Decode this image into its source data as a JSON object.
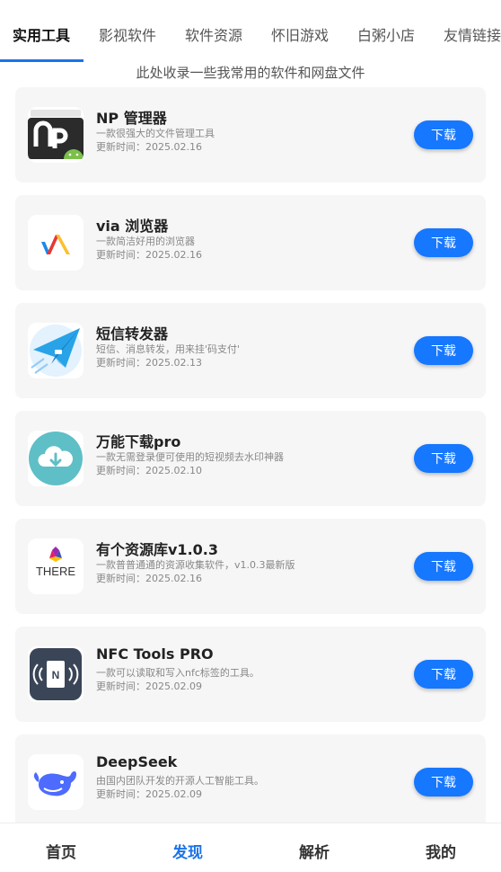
{
  "tabs": [
    {
      "label": "实用工具",
      "active": true
    },
    {
      "label": "影视软件",
      "active": false
    },
    {
      "label": "软件资源",
      "active": false
    },
    {
      "label": "怀旧游戏",
      "active": false
    },
    {
      "label": "白粥小店",
      "active": false
    },
    {
      "label": "友情链接",
      "active": false
    }
  ],
  "subtitle": "此处收录一些我常用的软件和网盘文件",
  "apps": [
    {
      "name": "NP 管理器",
      "desc": "一款很强大的文件管理工具",
      "time": "更新时间：2025.02.16",
      "icon": "np-manager-icon",
      "button": "下载"
    },
    {
      "name": "via 浏览器",
      "desc": "一款简洁好用的浏览器",
      "time": "更新时间：2025.02.16",
      "icon": "via-browser-icon",
      "button": "下载"
    },
    {
      "name": "短信转发器",
      "desc": "短信、消息转发，用来挂'码支付'",
      "time": "更新时间：2025.02.13",
      "icon": "paper-plane-icon",
      "button": "下载"
    },
    {
      "name": "万能下载pro",
      "desc": "一款无需登录便可使用的短视频去水印神器",
      "time": "更新时间：2025.02.10",
      "icon": "cloud-download-icon",
      "button": "下载"
    },
    {
      "name": "有个资源库v1.0.3",
      "desc": "一款普普通通的资源收集软件，v1.0.3最新版",
      "time": "更新时间：2025.02.16",
      "icon": "there-logo-icon",
      "button": "下载",
      "icon_text": "THERE"
    },
    {
      "name": "NFC Tools PRO",
      "desc": "一款可以读取和写入nfc标签的工具。",
      "time": "更新时间：2025.02.09",
      "icon": "nfc-icon",
      "button": "下载",
      "icon_text": "N"
    },
    {
      "name": "DeepSeek",
      "desc": "由国内团队开发的开源人工智能工具。",
      "time": "更新时间：2025.02.09",
      "icon": "deepseek-whale-icon",
      "button": "下载"
    }
  ],
  "bottom_nav": [
    {
      "label": "首页",
      "active": false
    },
    {
      "label": "发现",
      "active": true
    },
    {
      "label": "解析",
      "active": false
    },
    {
      "label": "我的",
      "active": false
    }
  ],
  "colors": {
    "accent": "#1677ff",
    "active_tab": "#1a73e8"
  }
}
